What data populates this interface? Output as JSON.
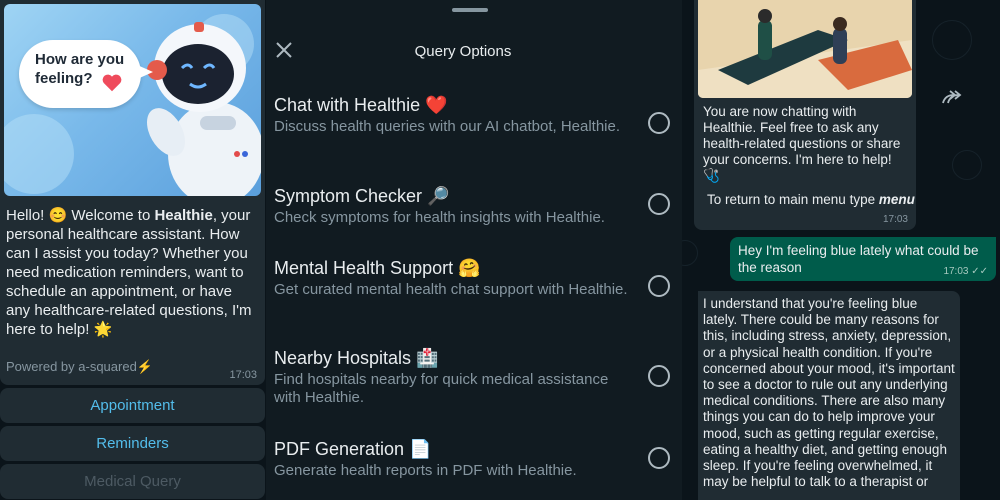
{
  "left": {
    "hero_speech": "How are you feeling?",
    "intro_prefix": "Hello! 😊 Welcome to ",
    "intro_brand": "Healthie",
    "intro_rest": ", your personal healthcare assistant. How can I assist you today? Whether you need medication reminders, want to schedule an appointment, or have any healthcare-related questions, I'm here to help! 🌟",
    "powered_by": "Powered by a-squared⚡",
    "time": "17:03",
    "buttons": [
      "Appointment",
      "Reminders",
      "Medical Query"
    ]
  },
  "sheet": {
    "title": "Query Options",
    "options": [
      {
        "title": "Chat with Healthie ❤️",
        "desc": "Discuss health queries with our AI chatbot, Healthie."
      },
      {
        "title": "Symptom Checker 🔎",
        "desc": "Check symptoms for health insights with Healthie."
      },
      {
        "title": "Mental Health Support 🤗",
        "desc": "Get curated mental health chat support with Healthie."
      },
      {
        "title": "Nearby Hospitals 🏥",
        "desc": "Find hospitals nearby for quick medical assistance with Healthie."
      },
      {
        "title": "PDF Generation 📄",
        "desc": "Generate health reports in PDF with Healthie."
      }
    ]
  },
  "chat": {
    "bot_intro": "You are now chatting with Healthie. Feel free to ask any health-related questions or share your concerns. I'm here to help! 🩺",
    "return_prefix": "To return to main menu type ",
    "return_keyword": "menu",
    "bot_intro_time": "17:03",
    "user_msg": "Hey I'm feeling blue lately what could be the reason",
    "user_time": "17:03 ✓✓",
    "bot_reply": "I understand that you're feeling blue lately. There could be many reasons for this, including stress, anxiety, depression, or a physical health condition. If you're concerned about your mood, it's important to see a doctor to rule out any underlying medical conditions. There are also many things you can do to help improve your mood, such as getting regular exercise, eating a healthy diet, and getting enough sleep. If you're feeling overwhelmed, it may be helpful to talk to a therapist or"
  },
  "colors": {
    "background": "#0b141a",
    "bubble_in": "#202c33",
    "bubble_out": "#005c4b",
    "link_blue": "#53bdeb",
    "sheet_bg": "#111b21"
  }
}
